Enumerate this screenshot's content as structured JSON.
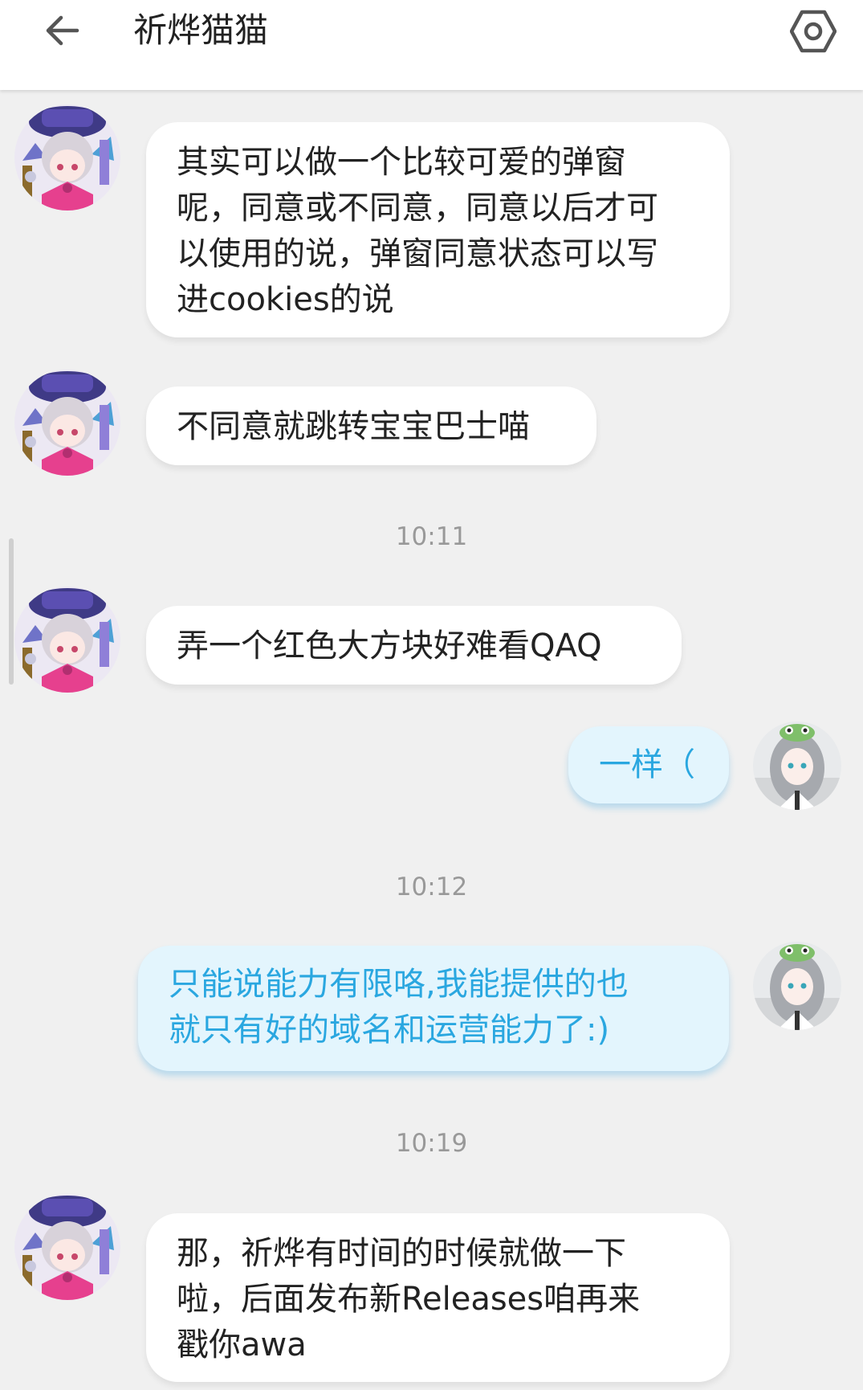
{
  "header": {
    "title": "祈烨猫猫",
    "back_icon": "arrow-left-icon",
    "settings_icon": "hexagon-settings-icon"
  },
  "messages": [
    {
      "from": "other",
      "text": "其实可以做一个比较可爱的弹窗\n呢，同意或不同意，同意以后才可\n以使用的说，弹窗同意状态可以写\n进cookies的说"
    },
    {
      "from": "other",
      "text": "不同意就跳转宝宝巴士喵"
    },
    {
      "type": "time",
      "text": "10:11"
    },
    {
      "from": "other",
      "text": "弄一个红色大方块好难看QAQ"
    },
    {
      "from": "self",
      "text": "一样（"
    },
    {
      "type": "time",
      "text": "10:12"
    },
    {
      "from": "self",
      "text": "只能说能力有限咯,我能提供的也\n就只有好的域名和运营能力了:)"
    },
    {
      "type": "time",
      "text": "10:19"
    },
    {
      "from": "other",
      "text": "那，祈烨有时间的时候就做一下\n啦，后面发布新Releases咱再来\n戳你awa"
    }
  ],
  "colors": {
    "background": "#f0f0f0",
    "other_bubble": "#ffffff",
    "self_bubble": "#e3f5fd",
    "self_text": "#2aa7e0",
    "other_text": "#222222",
    "time_text": "#999999"
  }
}
